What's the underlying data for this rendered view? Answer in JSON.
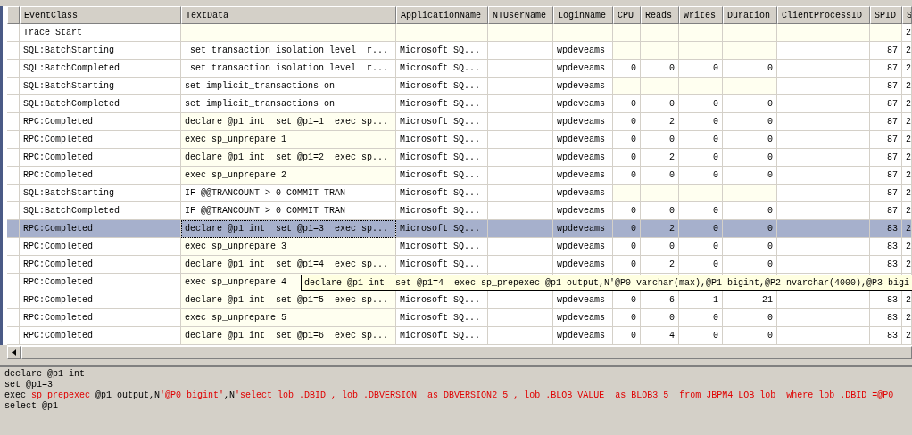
{
  "table": {
    "columns": [
      "EventClass",
      "TextData",
      "ApplicationName",
      "NTUserName",
      "LoginName",
      "CPU",
      "Reads",
      "Writes",
      "Duration",
      "ClientProcessID",
      "SPID",
      "S"
    ],
    "rows": [
      {
        "selected": false,
        "cells": [
          {
            "text": "Trace Start"
          },
          {
            "shaded": true
          },
          {
            "shaded": true
          },
          {
            "shaded": true
          },
          {
            "shaded": true
          },
          {
            "shaded": true
          },
          {
            "shaded": true
          },
          {
            "shaded": true
          },
          {
            "shaded": true
          },
          {
            "shaded": true
          },
          {
            "shaded": true
          },
          {
            "text": "2"
          }
        ]
      },
      {
        "selected": false,
        "cells": [
          {
            "text": "SQL:BatchStarting"
          },
          {
            "text": " set transaction isolation level  r..."
          },
          {
            "text": "Microsoft SQ..."
          },
          null,
          {
            "text": "wpdeveams"
          },
          {
            "shaded": true
          },
          {
            "shaded": true
          },
          {
            "shaded": true
          },
          {
            "shaded": true
          },
          null,
          {
            "text": "87"
          },
          {
            "text": "2"
          }
        ]
      },
      {
        "selected": false,
        "cells": [
          {
            "text": "SQL:BatchCompleted"
          },
          {
            "text": " set transaction isolation level  r..."
          },
          {
            "text": "Microsoft SQ..."
          },
          null,
          {
            "text": "wpdeveams"
          },
          {
            "text": "0"
          },
          {
            "text": "0"
          },
          {
            "text": "0"
          },
          {
            "text": "0"
          },
          null,
          {
            "text": "87"
          },
          {
            "text": "2"
          }
        ]
      },
      {
        "selected": false,
        "cells": [
          {
            "text": "SQL:BatchStarting"
          },
          {
            "text": "set implicit_transactions on"
          },
          {
            "text": "Microsoft SQ..."
          },
          null,
          {
            "text": "wpdeveams"
          },
          {
            "shaded": true
          },
          {
            "shaded": true
          },
          {
            "shaded": true
          },
          {
            "shaded": true
          },
          null,
          {
            "text": "87"
          },
          {
            "text": "2"
          }
        ]
      },
      {
        "selected": false,
        "cells": [
          {
            "text": "SQL:BatchCompleted"
          },
          {
            "text": "set implicit_transactions on"
          },
          {
            "text": "Microsoft SQ..."
          },
          null,
          {
            "text": "wpdeveams"
          },
          {
            "text": "0"
          },
          {
            "text": "0"
          },
          {
            "text": "0"
          },
          {
            "text": "0"
          },
          null,
          {
            "text": "87"
          },
          {
            "text": "2"
          }
        ]
      },
      {
        "selected": false,
        "cells": [
          {
            "text": "RPC:Completed"
          },
          {
            "text": "declare @p1 int  set @p1=1  exec sp...",
            "shaded": true
          },
          {
            "text": "Microsoft SQ..."
          },
          null,
          {
            "text": "wpdeveams"
          },
          {
            "text": "0"
          },
          {
            "text": "2"
          },
          {
            "text": "0"
          },
          {
            "text": "0"
          },
          null,
          {
            "text": "87"
          },
          {
            "text": "2"
          }
        ]
      },
      {
        "selected": false,
        "cells": [
          {
            "text": "RPC:Completed"
          },
          {
            "text": "exec sp_unprepare 1",
            "shaded": true
          },
          {
            "text": "Microsoft SQ..."
          },
          null,
          {
            "text": "wpdeveams"
          },
          {
            "text": "0"
          },
          {
            "text": "0"
          },
          {
            "text": "0"
          },
          {
            "text": "0"
          },
          null,
          {
            "text": "87"
          },
          {
            "text": "2"
          }
        ]
      },
      {
        "selected": false,
        "cells": [
          {
            "text": "RPC:Completed"
          },
          {
            "text": "declare @p1 int  set @p1=2  exec sp...",
            "shaded": true
          },
          {
            "text": "Microsoft SQ..."
          },
          null,
          {
            "text": "wpdeveams"
          },
          {
            "text": "0"
          },
          {
            "text": "2"
          },
          {
            "text": "0"
          },
          {
            "text": "0"
          },
          null,
          {
            "text": "87"
          },
          {
            "text": "2"
          }
        ]
      },
      {
        "selected": false,
        "cells": [
          {
            "text": "RPC:Completed"
          },
          {
            "text": "exec sp_unprepare 2",
            "shaded": true
          },
          {
            "text": "Microsoft SQ..."
          },
          null,
          {
            "text": "wpdeveams"
          },
          {
            "text": "0"
          },
          {
            "text": "0"
          },
          {
            "text": "0"
          },
          {
            "text": "0"
          },
          null,
          {
            "text": "87"
          },
          {
            "text": "2"
          }
        ]
      },
      {
        "selected": false,
        "cells": [
          {
            "text": "SQL:BatchStarting"
          },
          {
            "text": "IF @@TRANCOUNT > 0 COMMIT TRAN"
          },
          {
            "text": "Microsoft SQ..."
          },
          null,
          {
            "text": "wpdeveams"
          },
          {
            "shaded": true
          },
          {
            "shaded": true
          },
          {
            "shaded": true
          },
          {
            "shaded": true
          },
          null,
          {
            "text": "87"
          },
          {
            "text": "2"
          }
        ]
      },
      {
        "selected": false,
        "cells": [
          {
            "text": "SQL:BatchCompleted"
          },
          {
            "text": "IF @@TRANCOUNT > 0 COMMIT TRAN"
          },
          {
            "text": "Microsoft SQ..."
          },
          null,
          {
            "text": "wpdeveams"
          },
          {
            "text": "0"
          },
          {
            "text": "0"
          },
          {
            "text": "0"
          },
          {
            "text": "0"
          },
          null,
          {
            "text": "87"
          },
          {
            "text": "2"
          }
        ]
      },
      {
        "selected": true,
        "cells": [
          {
            "text": "RPC:Completed"
          },
          {
            "text": "declare @p1 int  set @p1=3  exec sp..."
          },
          {
            "text": "Microsoft SQ..."
          },
          null,
          {
            "text": "wpdeveams"
          },
          {
            "text": "0"
          },
          {
            "text": "2"
          },
          {
            "text": "0"
          },
          {
            "text": "0"
          },
          null,
          {
            "text": "83"
          },
          {
            "text": "2"
          }
        ]
      },
      {
        "selected": false,
        "cells": [
          {
            "text": "RPC:Completed"
          },
          {
            "text": "exec sp_unprepare 3",
            "shaded": true
          },
          {
            "text": "Microsoft SQ..."
          },
          null,
          {
            "text": "wpdeveams"
          },
          {
            "text": "0"
          },
          {
            "text": "0"
          },
          {
            "text": "0"
          },
          {
            "text": "0"
          },
          null,
          {
            "text": "83"
          },
          {
            "text": "2"
          }
        ]
      },
      {
        "selected": false,
        "cells": [
          {
            "text": "RPC:Completed"
          },
          {
            "text": "declare @p1 int  set @p1=4  exec sp...",
            "shaded": true
          },
          {
            "text": "Microsoft SQ..."
          },
          null,
          {
            "text": "wpdeveams"
          },
          {
            "text": "0"
          },
          {
            "text": "2"
          },
          {
            "text": "0"
          },
          {
            "text": "0"
          },
          null,
          {
            "text": "83"
          },
          {
            "text": "2"
          }
        ]
      },
      {
        "selected": false,
        "cells": [
          {
            "text": "RPC:Completed"
          },
          {
            "text": "exec sp_unprepare 4",
            "shaded": true
          }
        ]
      },
      {
        "selected": false,
        "cells": [
          {
            "text": "RPC:Completed"
          },
          {
            "text": "declare @p1 int  set @p1=5  exec sp...",
            "shaded": true
          },
          {
            "text": "Microsoft SQ..."
          },
          null,
          {
            "text": "wpdeveams"
          },
          {
            "text": "0"
          },
          {
            "text": "6"
          },
          {
            "text": "1"
          },
          {
            "text": "21"
          },
          null,
          {
            "text": "83"
          },
          {
            "text": "2"
          }
        ]
      },
      {
        "selected": false,
        "cells": [
          {
            "text": "RPC:Completed"
          },
          {
            "text": "exec sp_unprepare 5",
            "shaded": true
          },
          {
            "text": "Microsoft SQ..."
          },
          null,
          {
            "text": "wpdeveams"
          },
          {
            "text": "0"
          },
          {
            "text": "0"
          },
          {
            "text": "0"
          },
          {
            "text": "0"
          },
          null,
          {
            "text": "83"
          },
          {
            "text": "2"
          }
        ]
      },
      {
        "selected": false,
        "cells": [
          {
            "text": "RPC:Completed"
          },
          {
            "text": "declare @p1 int  set @p1=6  exec sp...",
            "shaded": true
          },
          {
            "text": "Microsoft SQ..."
          },
          null,
          {
            "text": "wpdeveams"
          },
          {
            "text": "0"
          },
          {
            "text": "4"
          },
          {
            "text": "0"
          },
          {
            "text": "0"
          },
          null,
          {
            "text": "83"
          },
          {
            "text": "2"
          }
        ]
      }
    ]
  },
  "tooltip": {
    "text": "declare @p1 int  set @p1=4  exec sp_prepexec @p1 output,N'@P0 varchar(max),@P1 bigint,@P2 nvarchar(4000),@P3 bigi"
  },
  "sql_pane": {
    "lines": [
      {
        "segments": [
          {
            "kind": "plain",
            "text": "declare @p1 int"
          }
        ]
      },
      {
        "segments": [
          {
            "kind": "plain",
            "text": "set @p1=3"
          }
        ]
      },
      {
        "segments": [
          {
            "kind": "plain",
            "text": "exec "
          },
          {
            "kind": "string",
            "text": "sp_prepexec"
          },
          {
            "kind": "plain",
            "text": " @p1 output,N"
          },
          {
            "kind": "string",
            "text": "'@P0 bigint'"
          },
          {
            "kind": "plain",
            "text": ",N"
          },
          {
            "kind": "string",
            "text": "'select lob_.DBID_, lob_.DBVERSION_ as DBVERSION2_5_, lob_.BLOB_VALUE_ as BLOB3_5_ from JBPM4_LOB lob_ where lob_.DBID_=@P0"
          }
        ]
      },
      {
        "segments": [
          {
            "kind": "plain",
            "text": "select @p1"
          }
        ]
      }
    ]
  }
}
